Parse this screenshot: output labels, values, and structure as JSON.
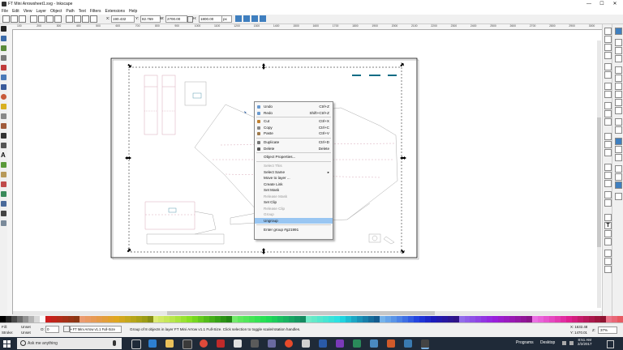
{
  "window": {
    "title": "FT Mini Arrowsheet1.svg - Inkscape"
  },
  "window_controls": {
    "minimize": "—",
    "maximize": "☐",
    "close": "✕"
  },
  "menu": [
    "File",
    "Edit",
    "View",
    "Layer",
    "Object",
    "Path",
    "Text",
    "Filters",
    "Extensions",
    "Help"
  ],
  "toolbar": {
    "x_label": "X:",
    "x_value": "190.432",
    "y_label": "Y:",
    "y_value": "82.769",
    "w_label": "W:",
    "w_value": "2700.00",
    "h_label": "H:",
    "h_value": "1800.00",
    "unit": "px"
  },
  "ruler_labels": [
    "100",
    "200",
    "300",
    "400",
    "500",
    "600",
    "700",
    "800",
    "900",
    "1000",
    "1100",
    "1200",
    "1300",
    "1400",
    "1500",
    "1600",
    "1700",
    "1800",
    "1900",
    "2000",
    "2100",
    "2200",
    "2300",
    "2400",
    "2500",
    "2600",
    "2700",
    "2800",
    "2900",
    "3000"
  ],
  "context_menu": {
    "items": [
      {
        "label": "Undo",
        "shortcut": "Ctrl+Z",
        "icon": "undo-icon",
        "disabled": false
      },
      {
        "label": "Redo",
        "shortcut": "Shift+Ctrl+Z",
        "icon": "redo-icon",
        "disabled": false
      },
      {
        "label": "Cut",
        "shortcut": "Ctrl+X",
        "icon": "cut-icon",
        "disabled": false
      },
      {
        "label": "Copy",
        "shortcut": "Ctrl+C",
        "icon": "copy-icon",
        "disabled": false
      },
      {
        "label": "Paste",
        "shortcut": "Ctrl+V",
        "icon": "paste-icon",
        "disabled": false
      },
      {
        "label": "Duplicate",
        "shortcut": "Ctrl+D",
        "icon": "duplicate-icon",
        "disabled": false
      },
      {
        "label": "Delete",
        "shortcut": "Delete",
        "icon": "delete-icon",
        "disabled": false
      },
      {
        "label": "Object Properties...",
        "shortcut": "",
        "icon": "",
        "disabled": false
      },
      {
        "label": "Select This",
        "shortcut": "",
        "icon": "",
        "disabled": true
      },
      {
        "label": "Select Same",
        "shortcut": "▸",
        "icon": "",
        "disabled": false
      },
      {
        "label": "Move to layer ...",
        "shortcut": "",
        "icon": "",
        "disabled": false
      },
      {
        "label": "Create Link",
        "shortcut": "",
        "icon": "",
        "disabled": false
      },
      {
        "label": "Set Mask",
        "shortcut": "",
        "icon": "",
        "disabled": false
      },
      {
        "label": "Release Mask",
        "shortcut": "",
        "icon": "",
        "disabled": true
      },
      {
        "label": "Set Clip",
        "shortcut": "",
        "icon": "",
        "disabled": false
      },
      {
        "label": "Release Clip",
        "shortcut": "",
        "icon": "",
        "disabled": true
      },
      {
        "label": "Group",
        "shortcut": "",
        "icon": "",
        "disabled": true
      },
      {
        "label": "Ungroup",
        "shortcut": "",
        "icon": "",
        "disabled": false,
        "highlighted": true
      },
      {
        "label": "Enter group #g21991",
        "shortcut": "",
        "icon": "",
        "disabled": false
      }
    ]
  },
  "status": {
    "fill_label": "Fill:",
    "fill_value": "Unset",
    "stroke_label": "Stroke:",
    "stroke_value": "Unset",
    "opacity_label": "O:",
    "opacity_value": "0",
    "layer": "• FT Mini Arrow v1.1 Full-Size",
    "message": "Group of 8 objects in layer FT Mini Arrow v1.1 Full-Size. Click selection to toggle scale/rotation handles.",
    "x_readout": "X: 1632.48",
    "y_readout": "Y: 1470.01",
    "z_label": "Z:",
    "zoom": "37%"
  },
  "taskbar": {
    "search_placeholder": "Ask me anything",
    "tray_programs": "Programs",
    "tray_desktop": "Desktop",
    "time": "8:51 AM",
    "date": "2/2/2017"
  },
  "colors": {
    "accent": "#0b6c85",
    "menu_highlight": "#99c6f2",
    "taskbar": "#1f2a38"
  }
}
